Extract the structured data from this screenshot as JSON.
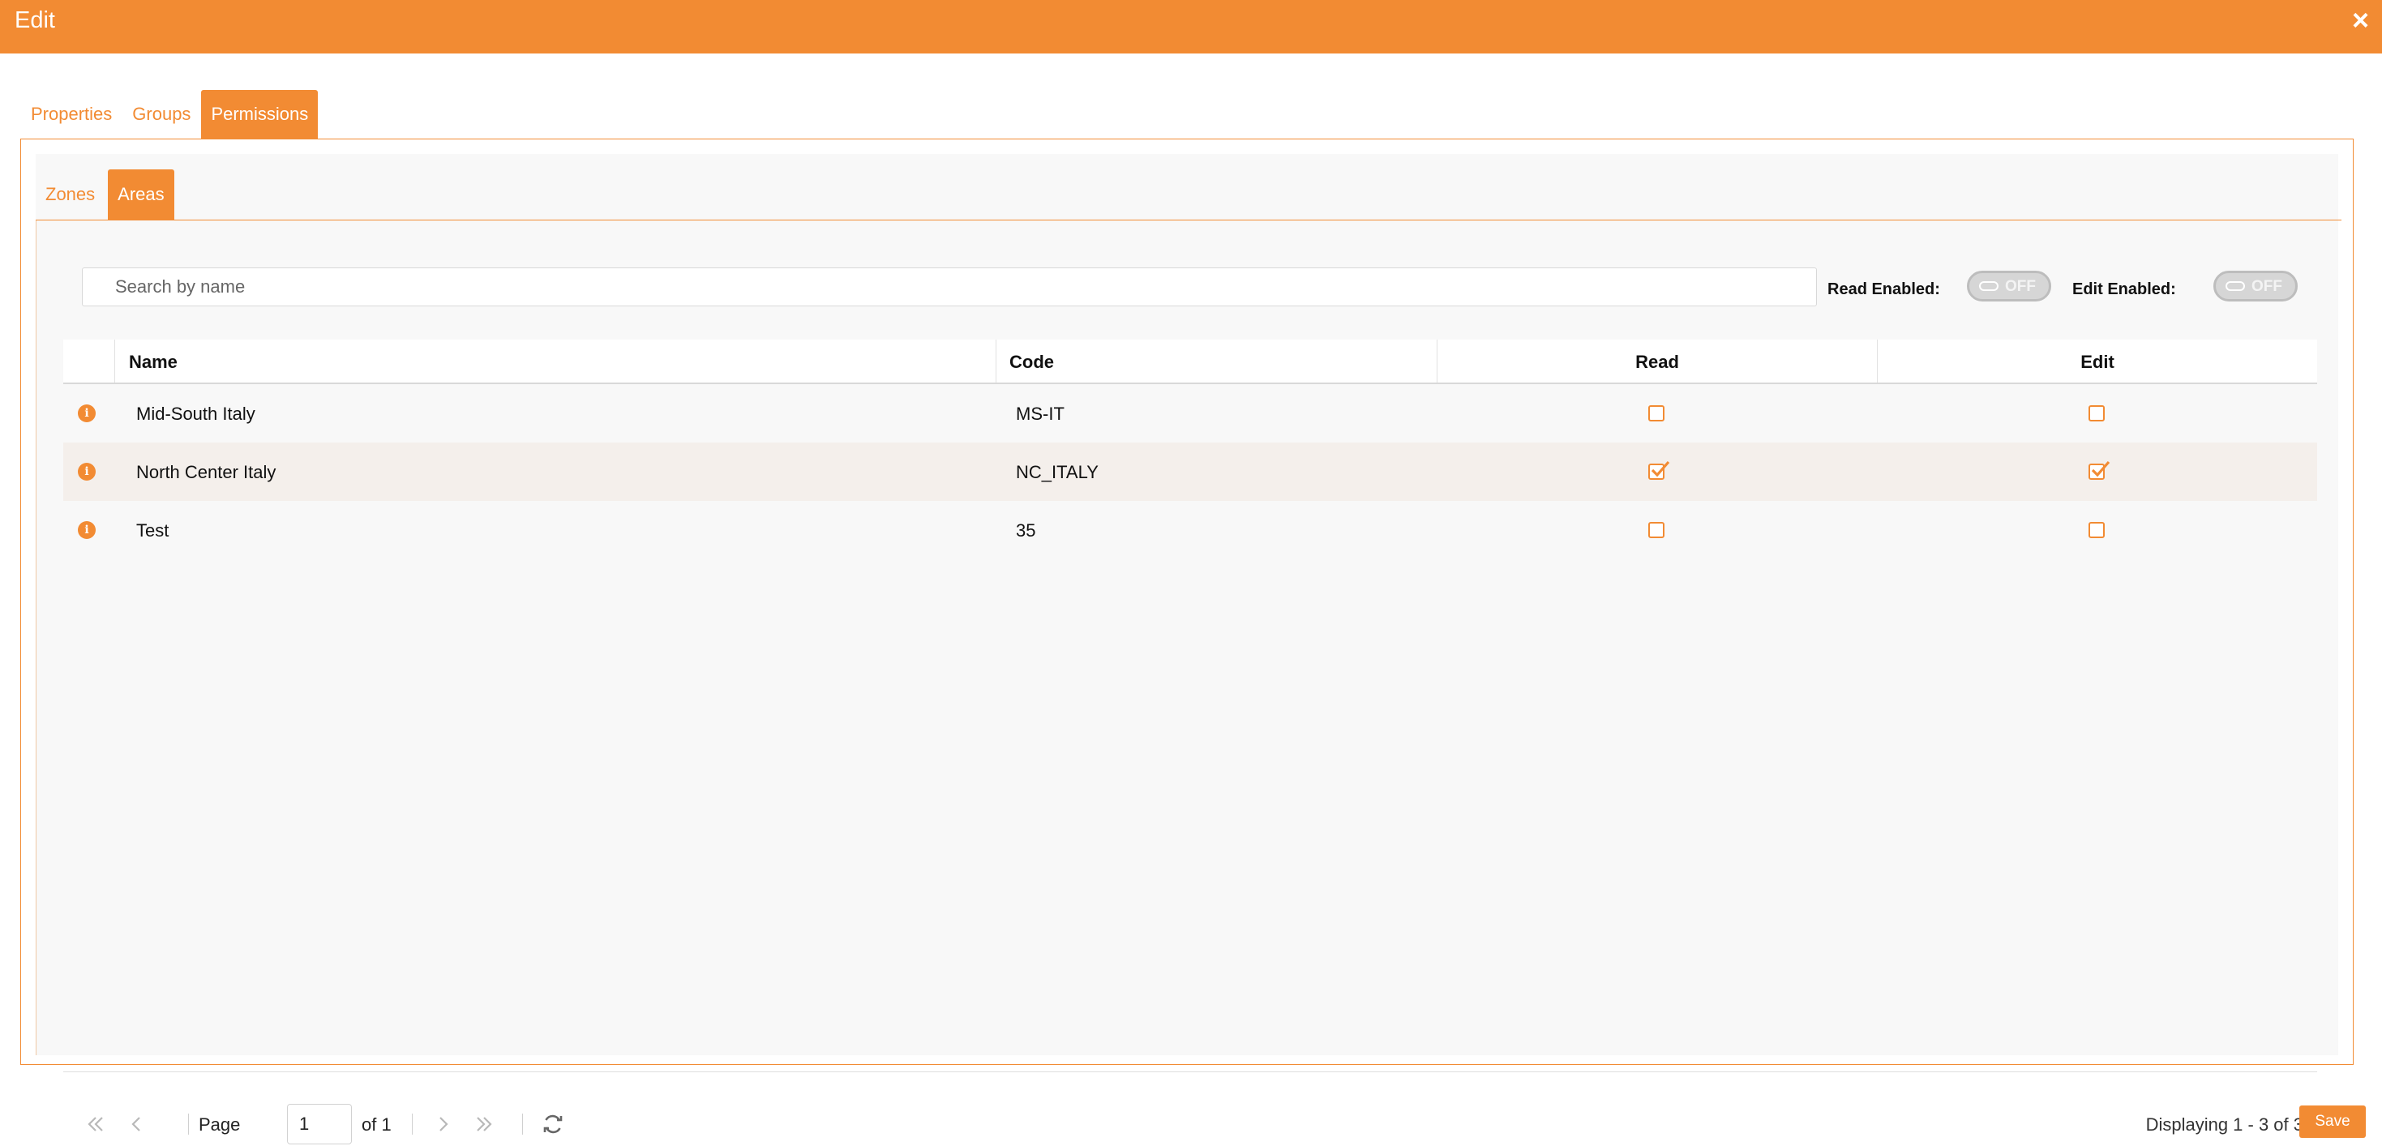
{
  "window": {
    "title": "Edit",
    "close_icon": "×"
  },
  "main_tabs": [
    {
      "label": "Properties",
      "active": false
    },
    {
      "label": "Groups",
      "active": false
    },
    {
      "label": "Permissions",
      "active": true
    }
  ],
  "sub_tabs": [
    {
      "label": "Zones",
      "active": false
    },
    {
      "label": "Areas",
      "active": true
    }
  ],
  "search": {
    "placeholder": "Search by name",
    "value": ""
  },
  "toggles": {
    "read": {
      "label": "Read Enabled:",
      "state": "OFF"
    },
    "edit": {
      "label": "Edit Enabled:",
      "state": "OFF"
    }
  },
  "grid": {
    "columns": [
      "Name",
      "Code",
      "Read",
      "Edit"
    ],
    "rows": [
      {
        "name": "Mid-South Italy",
        "code": "MS-IT",
        "read": false,
        "edit": false
      },
      {
        "name": "North Center Italy",
        "code": "NC_ITALY",
        "read": true,
        "edit": true
      },
      {
        "name": "Test",
        "code": "35",
        "read": false,
        "edit": false
      }
    ]
  },
  "pager": {
    "page_label": "Page",
    "page_value": "1",
    "of_label": "of 1",
    "display_text": "Displaying 1 - 3 of 3"
  },
  "footer": {
    "save_label": "Save"
  },
  "colors": {
    "accent": "#f28b33",
    "row_alt": "#f4efeb",
    "toggle_off": "#d6d6d6"
  },
  "icons": {
    "info": "info-icon",
    "first": "double-chevron-left-icon",
    "prev": "chevron-left-icon",
    "next": "chevron-right-icon",
    "last": "double-chevron-right-icon",
    "refresh": "refresh-icon",
    "close": "close-icon"
  }
}
